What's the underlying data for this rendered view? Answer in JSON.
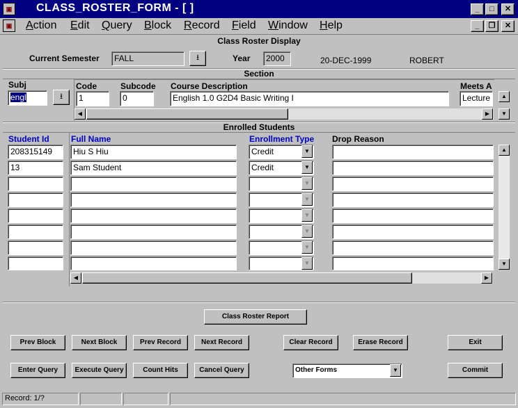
{
  "window": {
    "title": "CLASS_ROSTER_FORM - [ ]"
  },
  "menu": [
    {
      "label": "Action",
      "u": "A",
      "rest": "ction"
    },
    {
      "label": "Edit",
      "u": "E",
      "rest": "dit"
    },
    {
      "label": "Query",
      "u": "Q",
      "rest": "uery"
    },
    {
      "label": "Block",
      "u": "B",
      "rest": "lock"
    },
    {
      "label": "Record",
      "u": "R",
      "rest": "ecord"
    },
    {
      "label": "Field",
      "u": "F",
      "rest": "ield"
    },
    {
      "label": "Window",
      "u": "W",
      "rest": "indow"
    },
    {
      "label": "Help",
      "u": "H",
      "rest": "elp"
    }
  ],
  "header": {
    "form_title": "Class Roster Display",
    "semester_label": "Current Semester",
    "semester_value": "FALL",
    "year_label": "Year",
    "year_value": "2000",
    "date": "20-DEC-1999",
    "user": "ROBERT"
  },
  "section": {
    "title": "Section",
    "subj_label": "Subj",
    "subj_value": "engl",
    "code_label": "Code",
    "code_value": "1",
    "subcode_label": "Subcode",
    "subcode_value": "0",
    "desc_label": "Course Description",
    "desc_value": "English 1.0 G2D4 Basic Writing I",
    "meets_label": "Meets A",
    "meets_value": "Lecture"
  },
  "enrolled": {
    "title": "Enrolled Students",
    "col_student_id": "Student Id",
    "col_full_name": "Full Name",
    "col_enrollment_type": "Enrollment Type",
    "col_drop_reason": "Drop Reason",
    "rows": [
      {
        "student_id": "208315149",
        "full_name": "Hiu S Hiu",
        "enrollment_type": "Credit",
        "drop_reason": ""
      },
      {
        "student_id": "13",
        "full_name": "Sam  Student",
        "enrollment_type": "Credit",
        "drop_reason": ""
      },
      {
        "student_id": "",
        "full_name": "",
        "enrollment_type": "",
        "drop_reason": ""
      },
      {
        "student_id": "",
        "full_name": "",
        "enrollment_type": "",
        "drop_reason": ""
      },
      {
        "student_id": "",
        "full_name": "",
        "enrollment_type": "",
        "drop_reason": ""
      },
      {
        "student_id": "",
        "full_name": "",
        "enrollment_type": "",
        "drop_reason": ""
      },
      {
        "student_id": "",
        "full_name": "",
        "enrollment_type": "",
        "drop_reason": ""
      }
    ]
  },
  "buttons": {
    "class_roster_report": "Class Roster Report",
    "prev_block": "Prev Block",
    "next_block": "Next Block",
    "prev_record": "Prev Record",
    "next_record": "Next Record",
    "clear_record": "Clear Record",
    "erase_record": "Erase Record",
    "exit": "Exit",
    "enter_query": "Enter Query",
    "execute_query": "Execute Query",
    "count_hits": "Count Hits",
    "cancel_query": "Cancel Query",
    "other_forms": "Other Forms",
    "commit": "Commit"
  },
  "status": {
    "record": "Record: 1/?"
  }
}
